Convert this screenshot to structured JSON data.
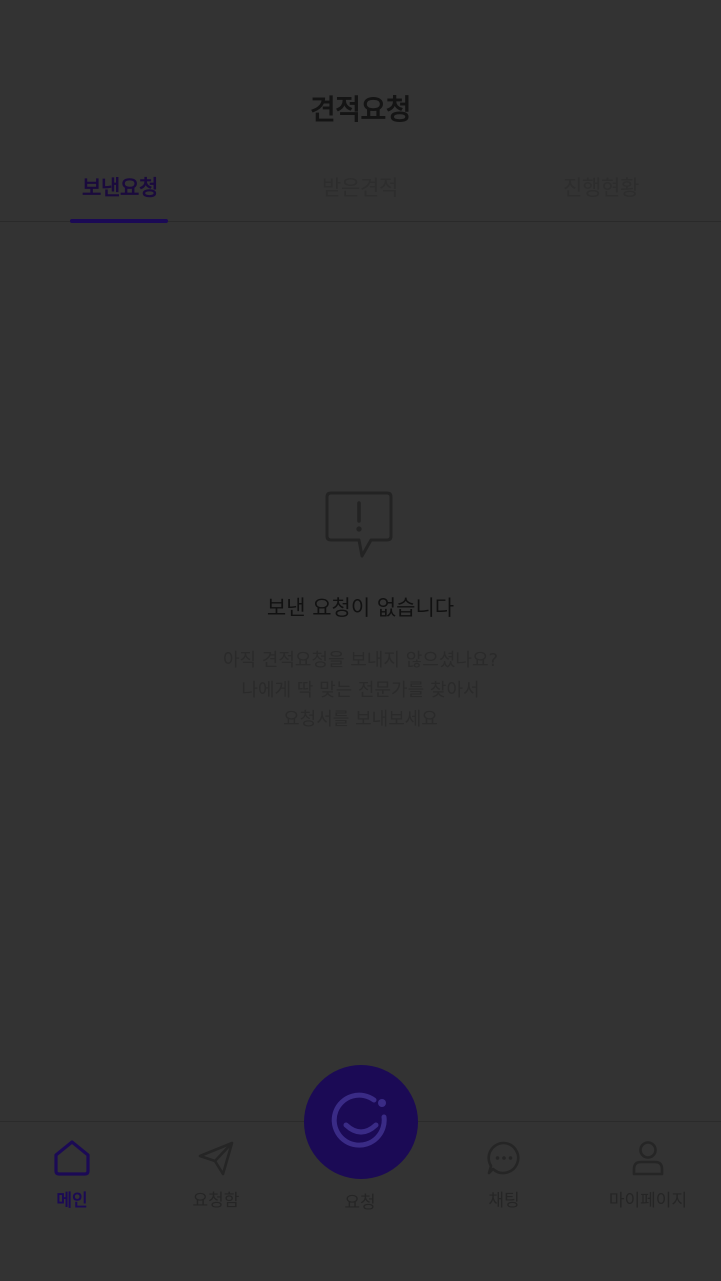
{
  "header": {
    "title": "견적요청"
  },
  "tabs": [
    {
      "label": "보낸요청",
      "active": true
    },
    {
      "label": "받은견적",
      "active": false
    },
    {
      "label": "진행현황",
      "active": false
    }
  ],
  "empty_state": {
    "icon": "alert-speech-bubble-icon",
    "title": "보낸 요청이 없습니다",
    "lines": [
      "아직 견적요청을 보내지 않으셨나요?",
      "나에게 딱 맞는 전문가를 찾아서",
      "요청서를 보내보세요"
    ]
  },
  "bottom_nav": {
    "items": [
      {
        "label": "메인",
        "icon": "home-icon",
        "active": true
      },
      {
        "label": "요청함",
        "icon": "paper-plane-icon",
        "active": false
      },
      {
        "label": "요청",
        "icon": "smile-logo-icon",
        "active": false
      },
      {
        "label": "채팅",
        "icon": "chat-bubble-icon",
        "active": false
      },
      {
        "label": "마이페이지",
        "icon": "person-icon",
        "active": false
      }
    ]
  },
  "colors": {
    "accent": "#1b0a55",
    "overlay_background": "#333333"
  }
}
